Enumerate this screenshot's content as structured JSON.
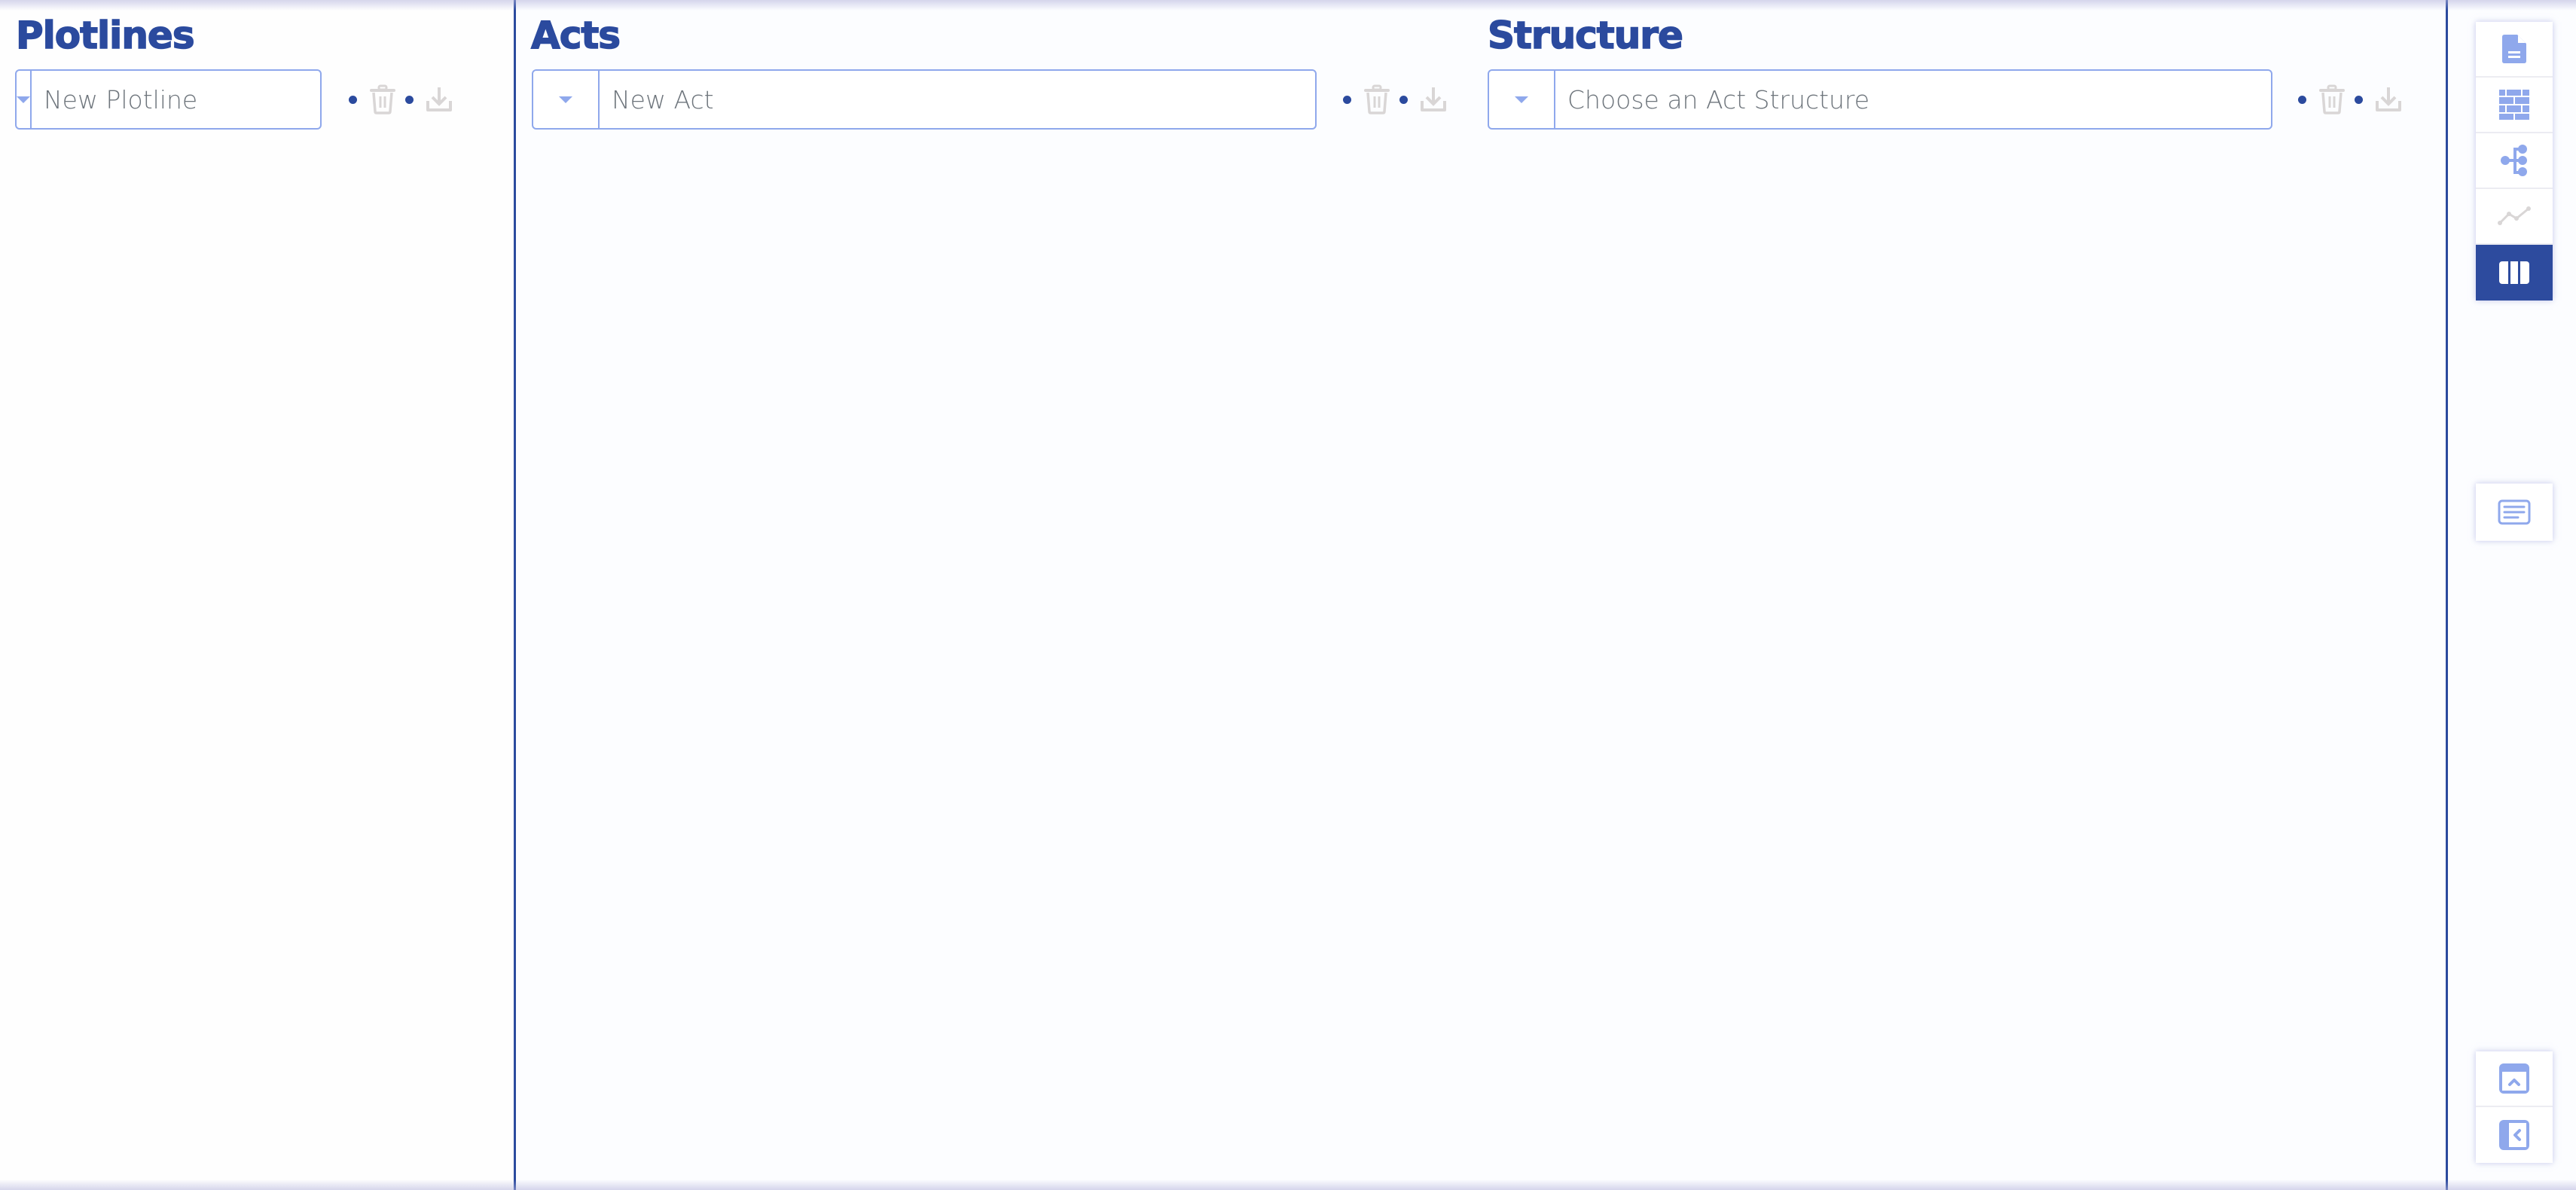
{
  "colors": {
    "brand": "#2b4a9e",
    "accent_light": "#8fa8ec",
    "icon_disabled": "#d9d6d6",
    "placeholder_text": "#6e757c"
  },
  "plotlines": {
    "heading": "Plotlines",
    "input_placeholder": "New Plotline",
    "input_value": "",
    "actions": [
      {
        "icon": "trash-icon",
        "label": "Delete plotline",
        "enabled": false
      },
      {
        "icon": "download-icon",
        "label": "Import plotline",
        "enabled": false
      }
    ]
  },
  "acts": {
    "heading": "Acts",
    "input_placeholder": "New Act",
    "input_value": "",
    "actions": [
      {
        "icon": "trash-icon",
        "label": "Delete act",
        "enabled": false
      },
      {
        "icon": "download-icon",
        "label": "Import act",
        "enabled": false
      }
    ]
  },
  "structure": {
    "heading": "Structure",
    "input_placeholder": "Choose an Act Structure",
    "input_value": "",
    "actions": [
      {
        "icon": "trash-icon",
        "label": "Delete structure",
        "enabled": false
      },
      {
        "icon": "download-icon",
        "label": "Import structure",
        "enabled": false
      }
    ]
  },
  "view_toolbar": {
    "items": [
      {
        "icon": "document-icon",
        "label": "Document view",
        "active": false
      },
      {
        "icon": "brick-wall-icon",
        "label": "Board view",
        "active": false
      },
      {
        "icon": "tree-structure-icon",
        "label": "Outline view",
        "active": false
      },
      {
        "icon": "line-chart-icon",
        "label": "Chart view",
        "active": false,
        "disabled": true
      },
      {
        "icon": "columns-icon",
        "label": "Acts view",
        "active": true
      }
    ]
  },
  "notes_toolbar": {
    "items": [
      {
        "icon": "notes-icon",
        "label": "Notes"
      }
    ]
  },
  "layout_toolbar": {
    "items": [
      {
        "icon": "panel-top-expand-icon",
        "label": "Toggle top panel"
      },
      {
        "icon": "panel-left-collapse-icon",
        "label": "Toggle side panel"
      }
    ]
  }
}
